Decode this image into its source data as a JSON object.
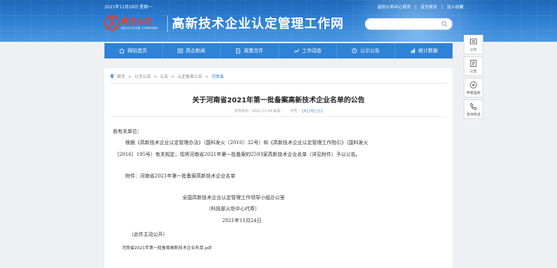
{
  "topbar": {
    "date": "2021年11月29日 星期一",
    "link_home": "返回火炬中心首页",
    "sep": "|",
    "link_set_home": "设为首页",
    "link_favorite": "加入收藏"
  },
  "logo": {
    "text": "高企认定",
    "subtext": "EDUCATION COMPANY"
  },
  "site_title": "高新技术企业认定管理工作网",
  "search": {
    "placeholder": ""
  },
  "nav": {
    "items": [
      {
        "label": "网站首页",
        "icon": "home-icon"
      },
      {
        "label": "高企新闻",
        "icon": "news-icon"
      },
      {
        "label": "政策文件",
        "icon": "document-icon"
      },
      {
        "label": "工作动态",
        "icon": "trend-icon"
      },
      {
        "label": "公示公告",
        "icon": "announcement-icon"
      },
      {
        "label": "统计数据",
        "icon": "statistics-icon"
      }
    ]
  },
  "side_tools": [
    {
      "label": "公示",
      "icon": "publicity-icon"
    },
    {
      "label": "公告",
      "icon": "notice-icon"
    },
    {
      "label": "申报指南",
      "icon": "compass-icon"
    },
    {
      "label": "咨询电话",
      "icon": "phone-icon"
    }
  ],
  "breadcrumb": {
    "items": [
      "首页",
      "公示公告",
      "公告",
      "认定备案公告",
      "河南省"
    ],
    "separator": ">"
  },
  "article": {
    "title": "关于河南省2021年第一批备案高新技术企业名单的公告",
    "meta_date": "发布时间：2021-11-24 来源：",
    "meta_font_label": "字号：",
    "font_large": "[大]",
    "font_medium": "[中]",
    "font_small": "[小]",
    "greeting": "各有关单位：",
    "para1_line1": "根据《高新技术企业认定管理办法》（国科发火〔2016〕32号）和《高新技术企业认定管理工作指引》（国科发火",
    "para1_line2": "〔2016〕195号）有关规定，现将河南省2021年第一批备案的2593家高新技术企业名单（详见附件）予以公告。",
    "attachment": "附件：河南省2021年第一批备案高新技术企业名单",
    "signature1": "全国高新技术企业认定管理工作领导小组办公室",
    "signature2": "（科技部火炬中心代章）",
    "sign_date": "2021年11月24日",
    "disclosure": "（此件主动公开）",
    "pdf_file": "河南省2021年第一批备案高新技术企业名单.pdf"
  },
  "colors": {
    "nav_blue": "#2f82d6",
    "header_blue": "#1d66b8",
    "logo_red": "#e8412b"
  }
}
